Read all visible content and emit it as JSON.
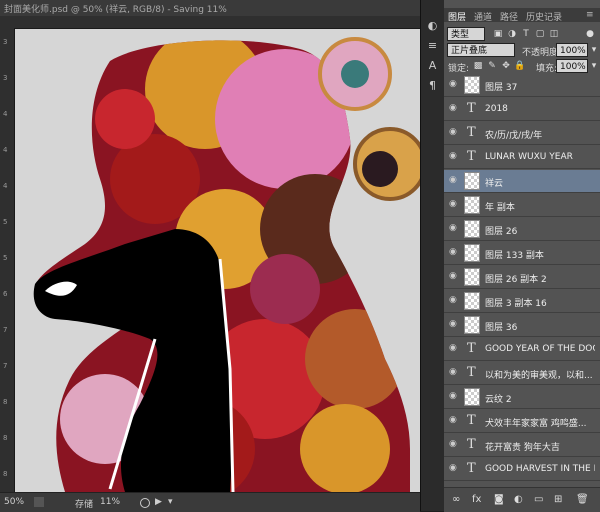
{
  "window": {
    "title": "封面美化师.psd @ 50% (祥云, RGB/8) - Saving 11%"
  },
  "ruler": {
    "left_ticks": [
      "3",
      "3",
      "4",
      "4",
      "4",
      "5",
      "5",
      "6",
      "7",
      "7",
      "8",
      "8",
      "8"
    ]
  },
  "status": {
    "zoom": "50%",
    "doc_label": "存储",
    "progress_text": "11%"
  },
  "panel": {
    "tabs": [
      "图层",
      "通道",
      "路径",
      "历史记录"
    ],
    "filter_kind": "类型",
    "blend_mode": "正片叠底",
    "opacity_label": "不透明度:",
    "opacity_value": "100%",
    "lock_label": "锁定:",
    "fill_label": "填充:",
    "fill_value": "100%"
  },
  "layers": [
    {
      "type": "image",
      "name": "图层 37"
    },
    {
      "type": "text",
      "name": "2018"
    },
    {
      "type": "text",
      "name": "农/历/戊/戌/年"
    },
    {
      "type": "text",
      "name": "LUNAR WUXU YEAR"
    },
    {
      "type": "image",
      "name": "祥云",
      "selected": true
    },
    {
      "type": "image",
      "name": "年 副本"
    },
    {
      "type": "image",
      "name": "图层 26"
    },
    {
      "type": "image",
      "name": "图层 133 副本"
    },
    {
      "type": "image",
      "name": "图层 26 副本 2"
    },
    {
      "type": "image",
      "name": "图层 3 副本 16"
    },
    {
      "type": "image",
      "name": "图层 36"
    },
    {
      "type": "text",
      "name": "GOOD YEAR OF THE DOG ..."
    },
    {
      "type": "text",
      "name": "以和为美的审美观，以和..."
    },
    {
      "type": "image",
      "name": "云纹 2"
    },
    {
      "type": "text",
      "name": "犬效丰年家家富  鸡鸣盛..."
    },
    {
      "type": "text",
      "name": "花开富贵      狗年大吉"
    },
    {
      "type": "text",
      "name": "GOOD HARVEST IN THE FA..."
    }
  ],
  "colors": {
    "selection": "#6a7c93",
    "panel": "#535353",
    "canvas_bg": "#d9d9d9",
    "accent_red": "#b3122a",
    "accent_gold": "#d9962a",
    "accent_pink": "#e07fb5"
  }
}
